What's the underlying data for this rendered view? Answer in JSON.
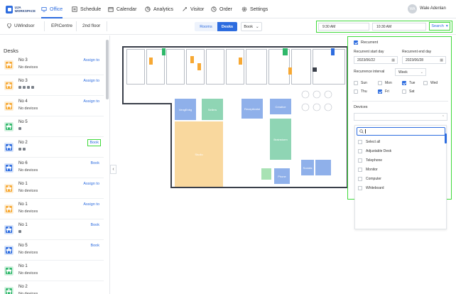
{
  "app": {
    "logo_line1": "UJA",
    "logo_line2": "WORKSPACE"
  },
  "nav": {
    "items": [
      {
        "label": "Office",
        "icon": "office-icon",
        "active": true
      },
      {
        "label": "Schedule",
        "icon": "schedule-icon"
      },
      {
        "label": "Calendar",
        "icon": "calendar-icon"
      },
      {
        "label": "Analytics",
        "icon": "analytics-icon"
      },
      {
        "label": "Visitor",
        "icon": "visitor-icon"
      },
      {
        "label": "Order",
        "icon": "order-icon"
      },
      {
        "label": "Settings",
        "icon": "settings-icon"
      }
    ],
    "user_initials": "WA",
    "user_name": "Wale Adenlan"
  },
  "location": {
    "site": "UWindsor",
    "building": "EPICentre",
    "floor": "2nd floor"
  },
  "view": {
    "rooms": "Rooms",
    "desks": "Desks",
    "book": "Book"
  },
  "time": {
    "start": "9:30 AM",
    "end": "10:30 AM",
    "search": "Search"
  },
  "sidebar": {
    "title": "Desks",
    "no_devices": "No devices",
    "desks": [
      {
        "name": "No 3",
        "action": "Assign to",
        "devices": 0,
        "color": "#f7a833"
      },
      {
        "name": "No 3",
        "action": "Assign to",
        "devices": 4,
        "color": "#f7a833"
      },
      {
        "name": "No 4",
        "action": "Assign to",
        "devices": 0,
        "color": "#f7a833"
      },
      {
        "name": "No 5",
        "action": "",
        "devices": 1,
        "color": "#2fb86a"
      },
      {
        "name": "No 2",
        "action": "Book",
        "devices": 2,
        "color": "#2d6cdf",
        "highlight": true
      },
      {
        "name": "No 6",
        "action": "Book",
        "devices": 0,
        "color": "#2d6cdf"
      },
      {
        "name": "No 1",
        "action": "Assign to",
        "devices": 0,
        "color": "#f7a833"
      },
      {
        "name": "No 1",
        "action": "Assign to",
        "devices": 0,
        "color": "#f7a833"
      },
      {
        "name": "No 1",
        "action": "Book",
        "devices": 1,
        "color": "#2d6cdf"
      },
      {
        "name": "No 5",
        "action": "Book",
        "devices": 0,
        "color": "#2d6cdf"
      },
      {
        "name": "No 1",
        "action": "",
        "devices": 0,
        "color": "#2fb86a"
      },
      {
        "name": "No 2",
        "action": "",
        "devices": 0,
        "color": "#2fb86a"
      }
    ]
  },
  "floorplan": {
    "zones": [
      {
        "label": "VengEnbg",
        "color": "#8fb0ea"
      },
      {
        "label": "Sellers",
        "color": "#8fd5b4"
      },
      {
        "label": "Receptionist",
        "color": "#8fb0ea"
      },
      {
        "label": "Creative",
        "color": "#8fb0ea"
      },
      {
        "label": "Studio",
        "color": "#f9d89e"
      },
      {
        "label": "Brainstorm",
        "color": "#8fd5b4"
      },
      {
        "label": "Socials",
        "color": "#8fb0ea"
      },
      {
        "label": "Phone",
        "color": "#8fb0ea"
      }
    ]
  },
  "filter": {
    "recurrent_label": "Recurrent",
    "start_label": "Recurrent start day",
    "end_label": "Recurrent end day",
    "start_value": "2023/06/22",
    "end_value": "2023/06/28",
    "interval_label": "Recurrence interval",
    "interval_value": "Week",
    "days": [
      {
        "label": "Sun",
        "on": false
      },
      {
        "label": "Mon",
        "on": false
      },
      {
        "label": "Tue",
        "on": true
      },
      {
        "label": "Wed",
        "on": false
      },
      {
        "label": "Thu",
        "on": false
      },
      {
        "label": "Fri",
        "on": true
      },
      {
        "label": "Sat",
        "on": false
      }
    ],
    "devices_label": "Devices",
    "options": [
      "Select all",
      "Adjustable Desk",
      "Telephone",
      "Monitor",
      "Computer",
      "Whiteboard"
    ]
  },
  "colors": {
    "accent": "#2d6cdf",
    "highlight": "#3fd93a"
  }
}
